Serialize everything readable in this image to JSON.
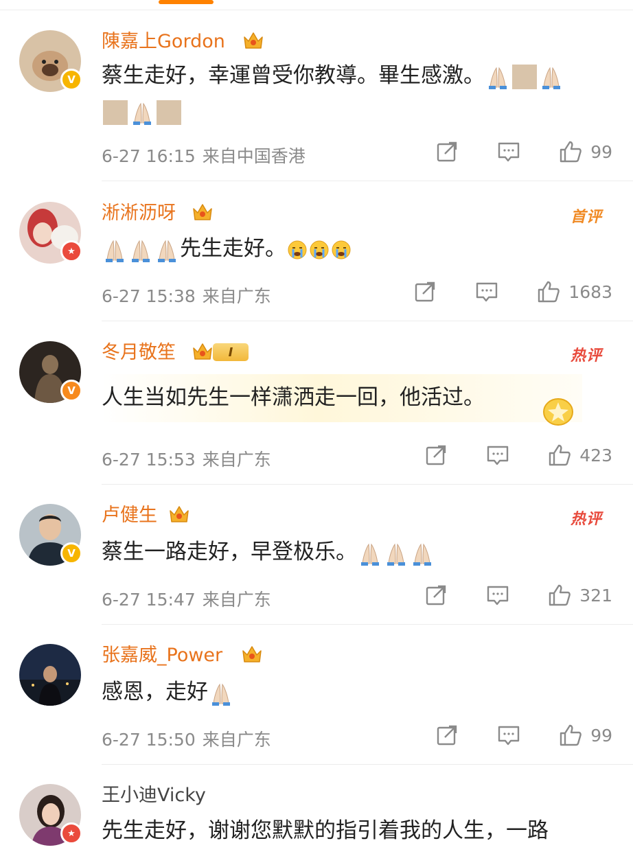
{
  "comments": [
    {
      "username": "陳嘉上Gordon",
      "text": "蔡生走好，幸運曾受你教導。畢生感激。",
      "time": "6-27 16:15",
      "location": "来自中国香港",
      "likes": "99",
      "badge": ""
    },
    {
      "username": "淅淅沥呀",
      "text": "先生走好。",
      "time": "6-27 15:38",
      "location": "来自广东",
      "likes": "1683",
      "badge": "首评"
    },
    {
      "username": "冬月敬笙",
      "level": "I",
      "text": "人生当如先生一样潇洒走一回，他活过。",
      "time": "6-27 15:53",
      "location": "来自广东",
      "likes": "423",
      "badge": "热评"
    },
    {
      "username": "卢健生",
      "text": "蔡生一路走好，早登极乐。",
      "time": "6-27 15:47",
      "location": "来自广东",
      "likes": "321",
      "badge": "热评"
    },
    {
      "username": "张嘉威_Power",
      "text": "感恩，走好",
      "time": "6-27 15:50",
      "location": "来自广东",
      "likes": "99",
      "badge": ""
    },
    {
      "username": "王小迪Vicky",
      "text": "先生走好，谢谢您默默的指引着我的人生，一路"
    }
  ],
  "icons": {
    "share": "share-icon",
    "reply": "comment-icon",
    "like": "thumbs-up-icon",
    "crown": "crown-icon",
    "verified": "verified-v-icon",
    "pray": "folded-hands-emoji",
    "cry": "crying-face-emoji"
  },
  "colors": {
    "accent": "#ff8200",
    "username": "#e8731c",
    "hot_badge": "#e84a3c",
    "first_badge": "#f08a24"
  }
}
